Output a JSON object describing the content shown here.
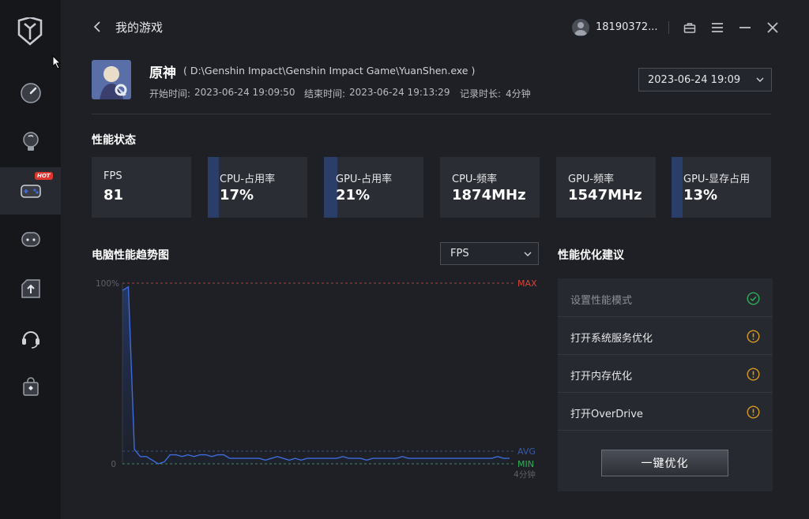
{
  "nav": {
    "hot_badge": "HOT"
  },
  "header": {
    "page_title": "我的游戏",
    "username": "18190372..."
  },
  "game": {
    "name": "原神",
    "path": "( D:\\Genshin Impact\\Genshin Impact Game\\YuanShen.exe )",
    "start_label": "开始时间:",
    "start_value": "2023-06-24 19:09:50",
    "end_label": "结束时间:",
    "end_value": "2023-06-24 19:13:29",
    "duration_label": "记录时长:",
    "duration_value": "4分钟",
    "session_selected": "2023-06-24 19:09"
  },
  "performance": {
    "title": "性能状态",
    "cards": [
      {
        "label": "FPS",
        "value": "81",
        "fill": 0
      },
      {
        "label": "CPU-占用率",
        "value": "17%",
        "fill": 0.17
      },
      {
        "label": "GPU-占用率",
        "value": "21%",
        "fill": 0.21
      },
      {
        "label": "CPU-频率",
        "value": "1874MHz",
        "fill": 0
      },
      {
        "label": "GPU-频率",
        "value": "1547MHz",
        "fill": 0
      },
      {
        "label": "GPU-显存占用",
        "value": "13%",
        "fill": 0.13
      }
    ]
  },
  "trend": {
    "title": "电脑性能趋势图",
    "metric_selected": "FPS"
  },
  "chart_data": {
    "type": "line",
    "y_top_label": "100%",
    "y_bottom_label": "0",
    "x_end_label": "4分钟",
    "max_label": "MAX",
    "avg_label": "AVG",
    "min_label": "MIN",
    "ylim": [
      0,
      100
    ],
    "avg_value": 7,
    "min_value": 0,
    "max_value": 100,
    "values": [
      96,
      98,
      8,
      4,
      4,
      2,
      0,
      1,
      5,
      5,
      4,
      5,
      4,
      5,
      5,
      4,
      5,
      5,
      3,
      3,
      3,
      3,
      3,
      3,
      2,
      3,
      4,
      3,
      2,
      3,
      2,
      3,
      3,
      3,
      3,
      3,
      3,
      4,
      3,
      3,
      3,
      2,
      3,
      3,
      3,
      3,
      3,
      4,
      3,
      3,
      3,
      3,
      3,
      3,
      3,
      3,
      3,
      3,
      3,
      3,
      3,
      3,
      3,
      4,
      3,
      3
    ],
    "colors": {
      "line": "#3d6bdc",
      "fill": "#1f3a7a",
      "max": "#d9423b",
      "avg": "#3b5aa8",
      "min": "#2fae5a"
    }
  },
  "suggestions": {
    "title": "性能优化建议",
    "items": [
      {
        "label": "设置性能模式",
        "status": "ok"
      },
      {
        "label": "打开系统服务优化",
        "status": "warn"
      },
      {
        "label": "打开内存优化",
        "status": "warn"
      },
      {
        "label": "打开OverDrive",
        "status": "warn"
      }
    ],
    "button_label": "一键优化"
  },
  "colors": {
    "accent": "#2b3e69",
    "ok": "#2fae5a",
    "warn": "#d99a1e"
  }
}
